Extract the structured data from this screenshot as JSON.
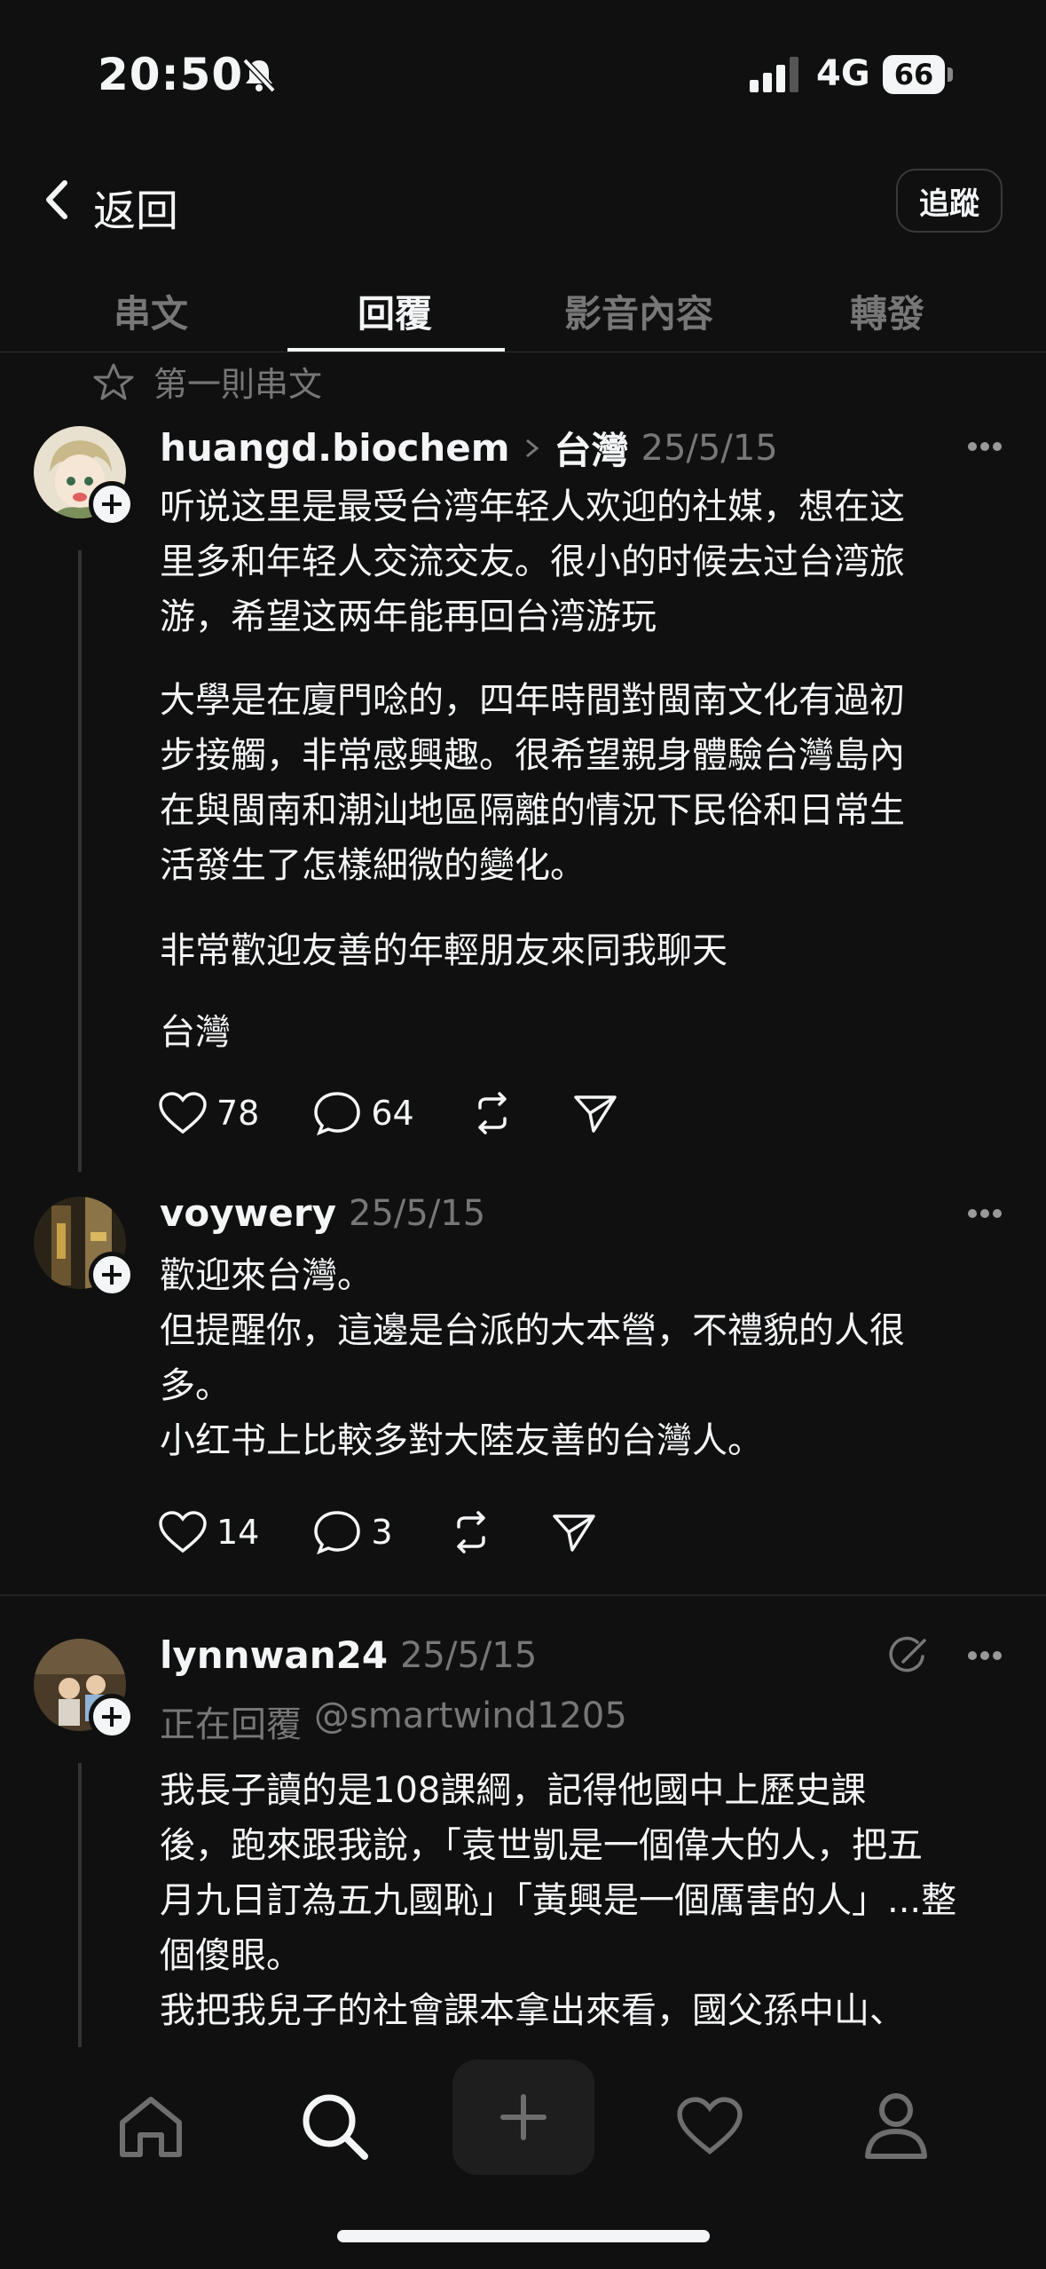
{
  "status_bar": {
    "time": "20:50",
    "network": "4G",
    "battery": "66"
  },
  "nav": {
    "back_label": "返回",
    "follow_label": "追蹤"
  },
  "tabs": [
    {
      "label": "串文",
      "active": false
    },
    {
      "label": "回覆",
      "active": true
    },
    {
      "label": "影音內容",
      "active": false
    },
    {
      "label": "轉發",
      "active": false
    }
  ],
  "first_post_label": "第一則串文",
  "posts": [
    {
      "username": "huangd.biochem",
      "topic": "台灣",
      "date": "25/5/15",
      "paragraphs": [
        "听说这里是最受台湾年轻人欢迎的社媒，想在这\n里多和年轻人交流交友。很小的时候去过台湾旅\n游，希望这两年能再回台湾游玩",
        "大學是在廈門唸的，四年時間對閩南文化有過初\n步接觸，非常感興趣。很希望親身體驗台灣島內\n在與閩南和潮汕地區隔離的情況下民俗和日常生\n活發生了怎樣細微的變化。",
        "非常歡迎友善的年輕朋友來同我聊天",
        "台灣"
      ],
      "likes": "78",
      "comments": "64"
    },
    {
      "username": "voywery",
      "date": "25/5/15",
      "text": "歡迎來台灣。\n但提醒你，這邊是台派的大本營，不禮貌的人很\n多。\n小红书上比較多對大陸友善的台灣人。",
      "likes": "14",
      "comments": "3"
    },
    {
      "username": "lynnwan24",
      "date": "25/5/15",
      "replying_prefix": "正在回覆",
      "replying_to": "@smartwind1205",
      "text": "我長子讀的是108課綱，記得他國中上歷史課\n後，跑來跟我說，「袁世凱是一個偉大的人，把五\n月九日訂為五九國恥」「黃興是一個厲害的人」...整\n個傻眼。\n我把我兒子的社會課本拿出來看，國父孫中山、"
    }
  ],
  "colors": {
    "background": "#101010",
    "text": "#f3f5f7",
    "muted": "#777777",
    "divider": "#2f2f2f"
  },
  "icons": [
    "bell-slash-icon",
    "signal-icon",
    "battery-icon",
    "chevron-left-icon",
    "star-icon",
    "heart-icon",
    "comment-icon",
    "repost-icon",
    "share-icon",
    "more-icon",
    "home-icon",
    "search-icon",
    "plus-icon",
    "activity-heart-icon",
    "profile-icon",
    "quote-edit-icon"
  ]
}
